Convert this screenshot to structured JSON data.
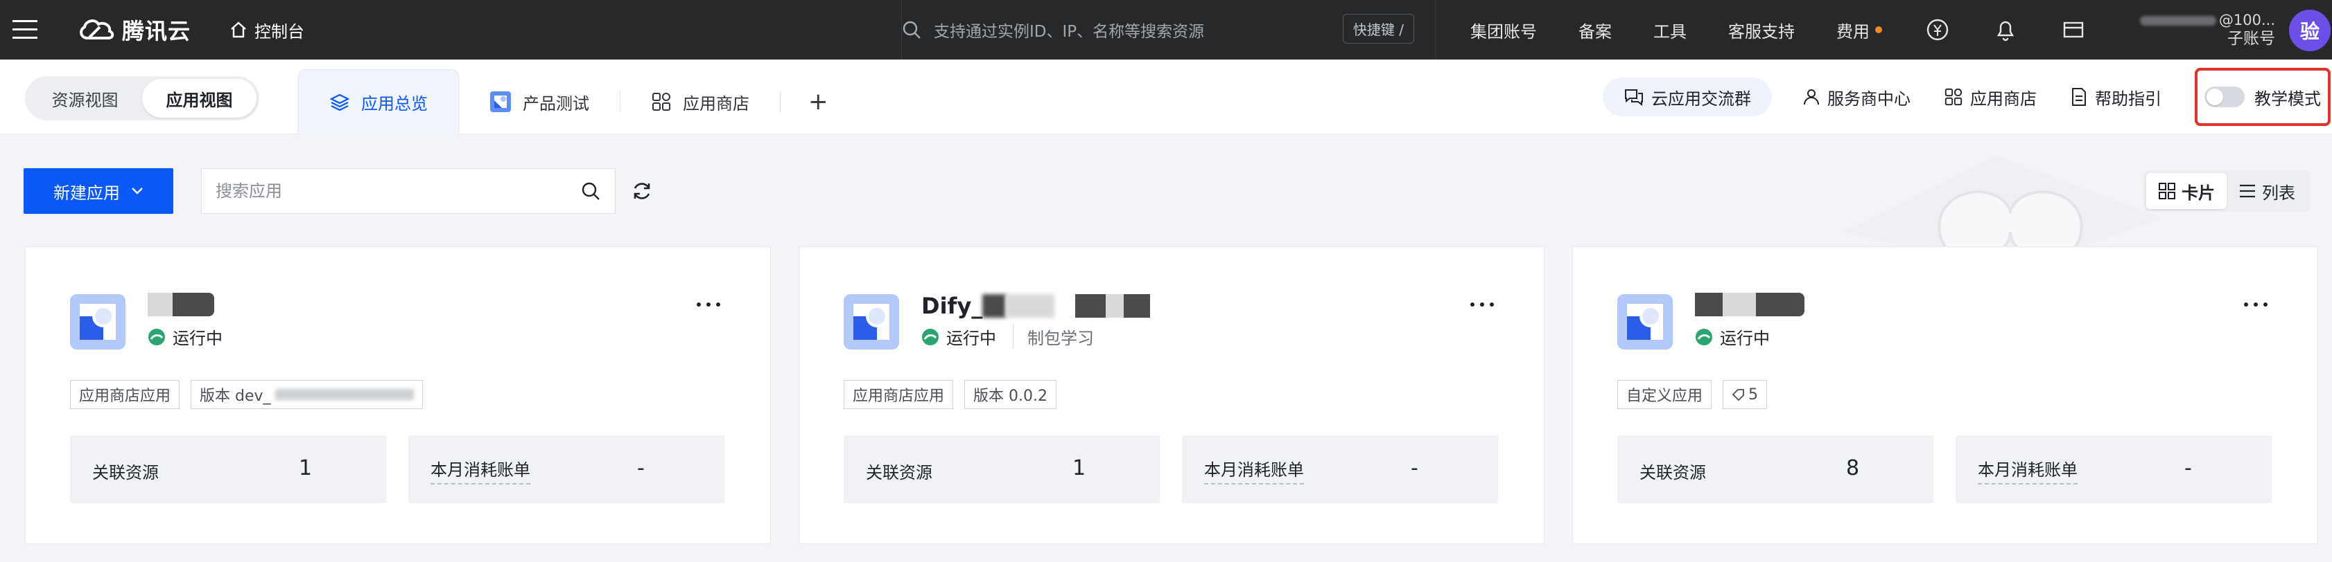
{
  "topbar": {
    "brand_name": "腾讯云",
    "console_label": "控制台",
    "search_placeholder": "支持通过实例ID、IP、名称等搜索资源",
    "shortcut_label": "快捷键 /",
    "links": [
      "集团账号",
      "备案",
      "工具",
      "客服支持",
      "费用"
    ],
    "account_id": "@100...",
    "account_role": "子账号",
    "avatar_text": "验"
  },
  "subbar": {
    "view_options": [
      "资源视图",
      "应用视图"
    ],
    "active_view": "应用视图",
    "tabs": [
      {
        "label": "应用总览",
        "active": true
      },
      {
        "label": "产品测试",
        "active": false
      },
      {
        "label": "应用商店",
        "active": false
      }
    ],
    "add_tab": "+",
    "community_label": "云应用交流群",
    "service_center": "服务商中心",
    "app_store": "应用商店",
    "help_guide": "帮助指引",
    "teaching_mode": "教学模式",
    "teaching_mode_on": false
  },
  "toolbar": {
    "new_app_label": "新建应用",
    "search_placeholder": "搜索应用",
    "layout_options": [
      "卡片",
      "列表"
    ],
    "active_layout": "卡片"
  },
  "cards": [
    {
      "title_visible": "",
      "status": "运行中",
      "status_sub": "",
      "tags": [
        "应用商店应用",
        "版本 dev_"
      ],
      "resources_label": "关联资源",
      "resources_value": "1",
      "bill_label": "本月消耗账单",
      "bill_value": "-"
    },
    {
      "title_visible": "Dify_",
      "status": "运行中",
      "status_sub": "制包学习",
      "tags": [
        "应用商店应用",
        "版本 0.0.2"
      ],
      "resources_label": "关联资源",
      "resources_value": "1",
      "bill_label": "本月消耗账单",
      "bill_value": "-"
    },
    {
      "title_visible": "",
      "status": "运行中",
      "status_sub": "",
      "tags": [
        "自定义应用",
        "5"
      ],
      "resources_label": "关联资源",
      "resources_value": "8",
      "bill_label": "本月消耗账单",
      "bill_value": "-"
    }
  ],
  "colors": {
    "topbar_bg": "#272829",
    "primary": "#0a59f7",
    "status_green": "#2ba471",
    "highlight_red": "#e0322b",
    "avatar_purple": "#6d4fe8"
  }
}
